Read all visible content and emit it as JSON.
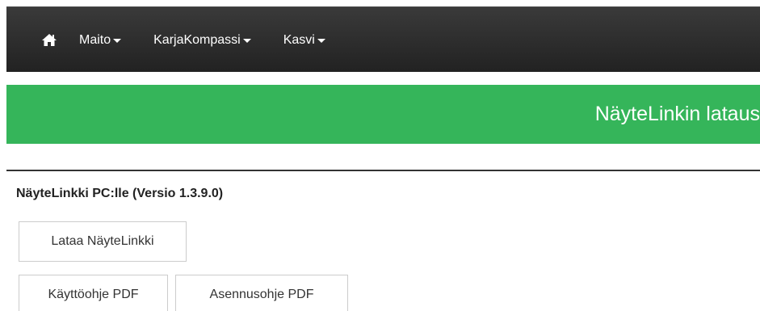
{
  "navbar": {
    "home_icon": "home-icon",
    "items": [
      {
        "label": "Maito",
        "icon": "caret-down-icon"
      },
      {
        "label": "KarjaKompassi",
        "icon": "caret-down-icon"
      },
      {
        "label": "Kasvi",
        "icon": "caret-down-icon"
      }
    ]
  },
  "banner": {
    "title": "NäyteLinkin lataus",
    "color": "#35b55a"
  },
  "section": {
    "heading": "NäyteLinkki PC:lle (Versio 1.3.9.0)",
    "download_button": "Lataa NäyteLinkki",
    "manual_button": "Käyttöohje PDF",
    "install_button": "Asennusohje PDF"
  }
}
